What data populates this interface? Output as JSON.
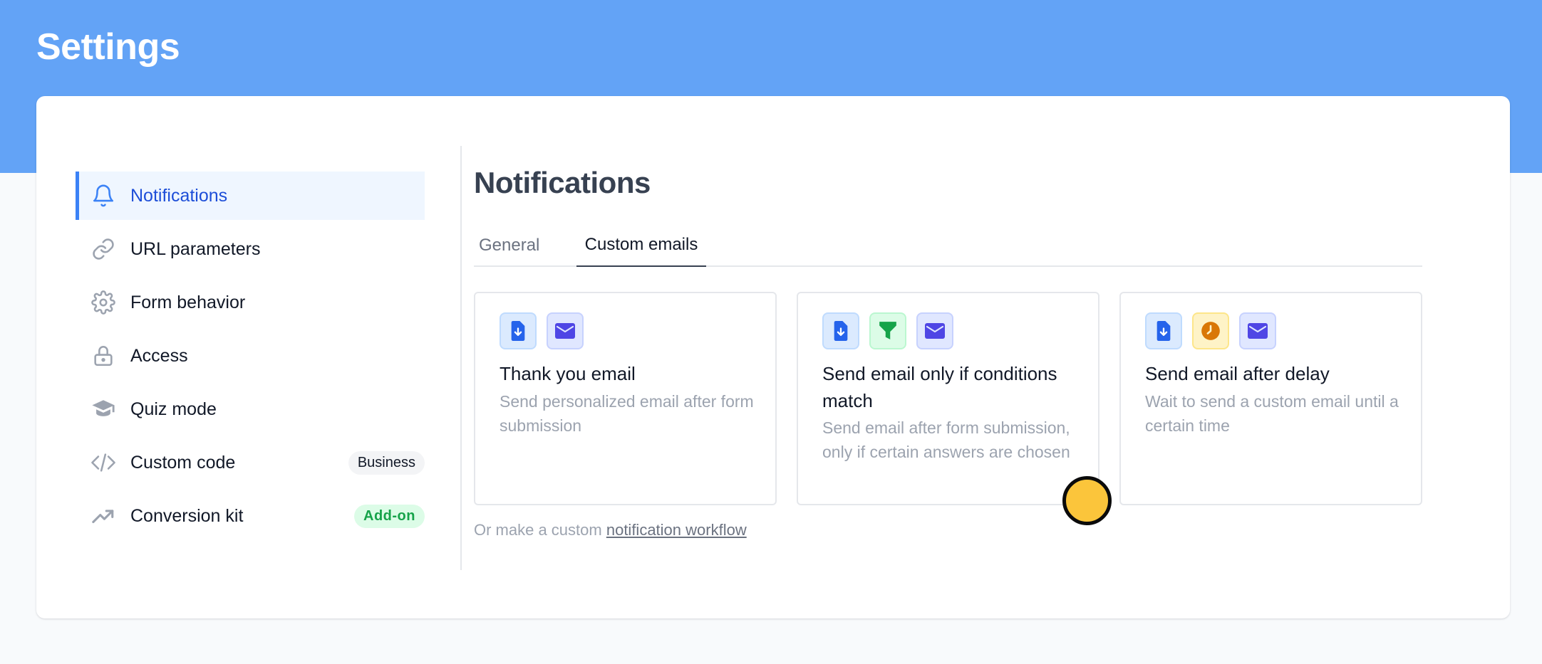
{
  "header": {
    "title": "Settings"
  },
  "sidebar": {
    "items": [
      {
        "label": "Notifications",
        "icon": "bell-icon",
        "active": true
      },
      {
        "label": "URL parameters",
        "icon": "link-icon"
      },
      {
        "label": "Form behavior",
        "icon": "gear-icon"
      },
      {
        "label": "Access",
        "icon": "lock-icon"
      },
      {
        "label": "Quiz mode",
        "icon": "graduation-cap-icon"
      },
      {
        "label": "Custom code",
        "icon": "code-icon",
        "badge": "Business"
      },
      {
        "label": "Conversion kit",
        "icon": "trending-up-icon",
        "badge": "Add-on"
      }
    ]
  },
  "main": {
    "title": "Notifications",
    "tabs": [
      {
        "label": "General",
        "active": false
      },
      {
        "label": "Custom emails",
        "active": true
      }
    ],
    "options": [
      {
        "title": "Thank you email",
        "description": "Send personalized email after form submission",
        "icons": [
          "file-download-icon",
          "mail-icon"
        ]
      },
      {
        "title": "Send email only if conditions match",
        "description": "Send email after form submission, only if certain answers are chosen",
        "icons": [
          "file-download-icon",
          "filter-icon",
          "mail-icon"
        ]
      },
      {
        "title": "Send email after delay",
        "description": "Wait to send a custom email until a certain time",
        "icons": [
          "file-download-icon",
          "clock-icon",
          "mail-icon"
        ]
      }
    ],
    "footnote": {
      "prefix": "Or make a custom ",
      "link": "notification workflow"
    }
  },
  "colors": {
    "banner": "#63a3f6",
    "accent": "#3b82f6",
    "cursor": "#fbc53b"
  }
}
